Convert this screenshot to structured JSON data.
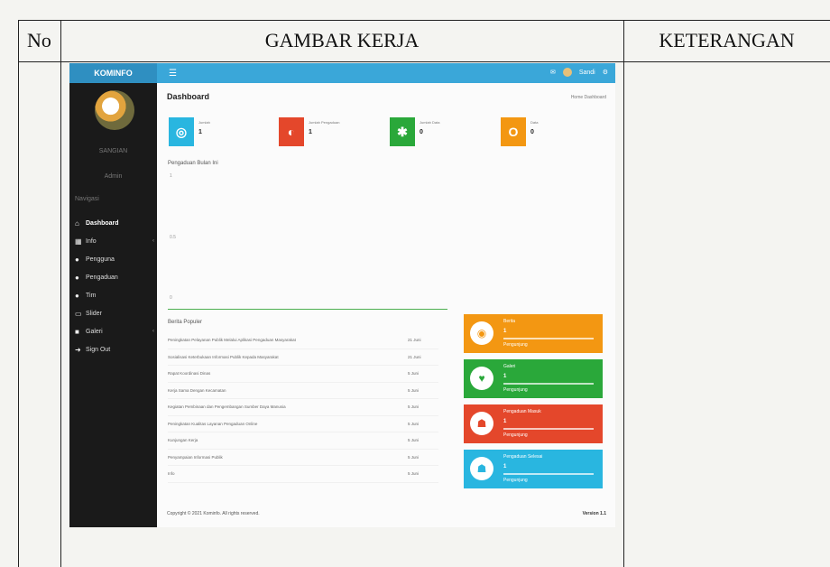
{
  "document": {
    "headers": {
      "no": "No",
      "gambar": "GAMBAR KERJA",
      "keterangan": "KETERANGAN"
    }
  },
  "screenshot": {
    "logo": "KOMINFO",
    "topbar": {
      "menu_icon": "bars-icon",
      "username": "Sandi"
    },
    "sidebar": {
      "user_name": "SANGIAN",
      "user_role": "Admin",
      "section": "Navigasi",
      "menu": [
        {
          "label": "Dashboard",
          "icon": "home-icon",
          "active": true
        },
        {
          "label": "Info",
          "icon": "grid-icon",
          "caret": true
        },
        {
          "label": "Pengguna",
          "icon": "user-icon"
        },
        {
          "label": "Pengaduan",
          "icon": "users-icon"
        },
        {
          "label": "Tim",
          "icon": "user-icon"
        },
        {
          "label": "Slider",
          "icon": "image-icon"
        },
        {
          "label": "Galeri",
          "icon": "camera-icon",
          "caret": true
        },
        {
          "label": "Sign Out",
          "icon": "signout-icon"
        }
      ]
    },
    "page_title": "Dashboard",
    "breadcrumb": "Home  Dashboard",
    "stats": [
      {
        "label": "Jumlah",
        "count": "1",
        "color": "#29b6e0",
        "glyph": "◎"
      },
      {
        "label": "Jumlah Pengaduan",
        "count": "1",
        "color": "#e4472b",
        "glyph": "◐"
      },
      {
        "label": "Jumlah Data",
        "count": "0",
        "color": "#2aa83a",
        "glyph": "✱"
      },
      {
        "label": "Data",
        "count": "0",
        "color": "#f39712",
        "glyph": "O"
      }
    ],
    "chart_title": "Pengaduan Bulan Ini",
    "chart_ticks": [
      "1",
      "0.5",
      "0"
    ],
    "table_title": "Berita Populer",
    "table_rows": [
      {
        "title": "Peningkatan Pelayanan Publik Melalui Aplikasi Pengaduan Masyarakat",
        "date": "21 Juni"
      },
      {
        "title": "Sosialisasi Keterbukaan Informasi Publik Kepada Masyarakat",
        "date": "21 Juni"
      },
      {
        "title": "Rapat Koordinasi Dinas",
        "date": "5 Juni"
      },
      {
        "title": "Kerja Sama Dengan Kecamatan",
        "date": "5 Juni"
      },
      {
        "title": "Kegiatan Pembinaan dan Pengembangan Sumber Daya Manusia",
        "date": "5 Juni"
      },
      {
        "title": "Peningkatan Kualitas Layanan Pengaduan Online",
        "date": "5 Juni"
      },
      {
        "title": "Kunjungan Kerja",
        "date": "5 Juni"
      },
      {
        "title": "Penyampaian Informasi Publik",
        "date": "5 Juni"
      },
      {
        "title": "Info",
        "date": "5 Juni"
      }
    ],
    "cards": [
      {
        "t1": "Berita",
        "t2": "1",
        "t3": "Pengunjung",
        "color": "#f39712",
        "glyph": "◉"
      },
      {
        "t1": "Galeri",
        "t2": "1",
        "t3": "Pengunjung",
        "color": "#2aa83a",
        "glyph": "♥"
      },
      {
        "t1": "Pengaduan Masuk",
        "t2": "1",
        "t3": "Pengunjung",
        "color": "#e4472b",
        "glyph": "☗"
      },
      {
        "t1": "Pengaduan Selesai",
        "t2": "1",
        "t3": "Pengunjung",
        "color": "#29b6e0",
        "glyph": "☗"
      }
    ],
    "footer": "Copyright © 2021 Kominfo. All rights reserved.",
    "version": "Version 1.1"
  }
}
